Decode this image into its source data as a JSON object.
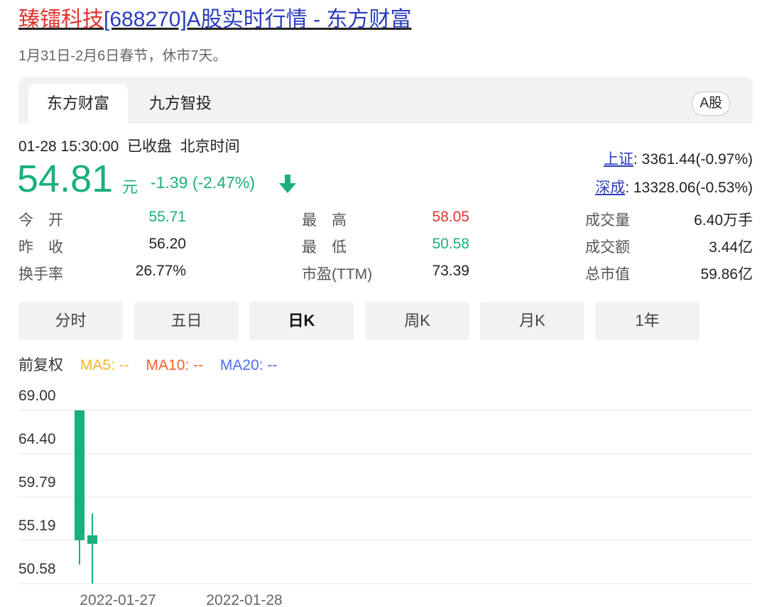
{
  "header": {
    "title_name": "臻镭科技",
    "title_rest": "[688270]A股实时行情 - 东方财富",
    "notice": "1月31日-2月6日春节，休市7天。"
  },
  "tabs": {
    "items": [
      {
        "label": "东方财富",
        "active": true
      },
      {
        "label": "九方智投",
        "active": false
      }
    ],
    "market_badge": "A股"
  },
  "quote": {
    "datetime": "01-28 15:30:00",
    "status": "已收盘",
    "timezone": "北京时间",
    "price": "54.81",
    "unit": "元",
    "change": "-1.39 (-2.47%)",
    "direction_icon": "down-arrow-icon"
  },
  "indices": [
    {
      "name": "上证",
      "value": ": 3361.44(-0.97%)"
    },
    {
      "name": "深成",
      "value": ": 13328.06(-0.53%)"
    }
  ],
  "stats": {
    "open": {
      "label": "今　开",
      "value": "55.71"
    },
    "prev_close": {
      "label": "昨　收",
      "value": "56.20"
    },
    "turnover_rate": {
      "label": "换手率",
      "value": "26.77%"
    },
    "high": {
      "label": "最　高",
      "value": "58.05"
    },
    "low": {
      "label": "最　低",
      "value": "50.58"
    },
    "pe": {
      "label": "市盈(TTM)",
      "value": "73.39"
    },
    "volume": {
      "label": "成交量",
      "value": "6.40万手"
    },
    "amount": {
      "label": "成交额",
      "value": "3.44亿"
    },
    "market_cap": {
      "label": "总市值",
      "value": "59.86亿"
    }
  },
  "period_buttons": [
    {
      "label": "分时",
      "active": false
    },
    {
      "label": "五日",
      "active": false
    },
    {
      "label": "日K",
      "active": true
    },
    {
      "label": "周K",
      "active": false
    },
    {
      "label": "月K",
      "active": false
    },
    {
      "label": "1年",
      "active": false
    }
  ],
  "legend": {
    "adjust": "前复权",
    "ma5": "MA5: --",
    "ma10": "MA10: --",
    "ma20": "MA20: --"
  },
  "colors": {
    "up": "#e3322d",
    "down": "#1aaf7d",
    "link": "#2a3dbd",
    "ma5": "#f5b52c",
    "ma10": "#f2612b",
    "ma20": "#4a6cf0"
  },
  "chart_data": {
    "type": "candlestick",
    "y_ticks": [
      "69.00",
      "64.40",
      "59.79",
      "55.19",
      "50.58"
    ],
    "ylim": [
      50.58,
      69.0
    ],
    "categories": [
      "2022-01-27",
      "2022-01-28"
    ],
    "candles": [
      {
        "date": "2022-01-27",
        "open": 69.0,
        "close": 55.19,
        "high": 69.0,
        "low": 52.6
      },
      {
        "date": "2022-01-28",
        "open": 55.71,
        "close": 54.81,
        "high": 58.05,
        "low": 50.58
      }
    ]
  }
}
